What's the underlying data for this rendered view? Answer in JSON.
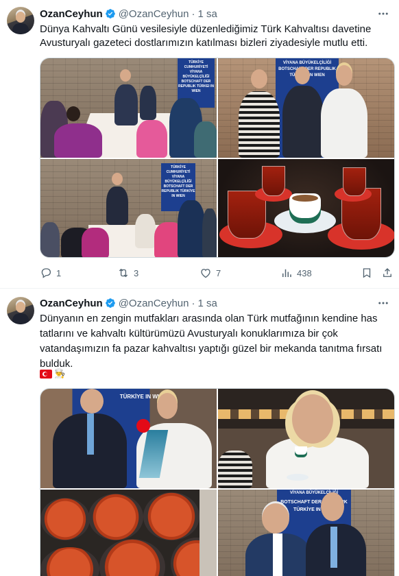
{
  "tweets": [
    {
      "name": "OzanCeyhun",
      "handle": "@OzanCeyhun",
      "dot": "·",
      "time": "1 sa",
      "text_lines": [
        "Dünya Kahvaltı Günü vesilesiyle düzenlediğimiz Türk Kahvaltısı davetine",
        "Avusturyalı gazeteci dostlarımızın katılması bizleri ziyadesiyle mutlu etti."
      ],
      "banners": {
        "p1": "TÜRKİYE CUMHURİYETİ VİYANA BÜYÜKELÇİLİĞİ BOTSCHAFT DER REPUBLIK TÜRKEI IN WIEN",
        "p2": "VİYANA BÜYÜKELÇİLİĞİ BOTSCHAFT DER REPUBLIK TÜRKİYE IN WIEN",
        "p3": "TÜRKİYE CUMHURİYETİ VİYANA BÜYÜKELÇİLİĞİ BOTSCHAFT DER REPUBLIK TÜRKİYE IN WIEN"
      },
      "replies": "1",
      "retweets": "3",
      "likes": "7",
      "views": "438"
    },
    {
      "name": "OzanCeyhun",
      "handle": "@OzanCeyhun",
      "dot": "·",
      "time": "1 sa",
      "text_lines": [
        "Dünyanın en zengin mutfakları arasında olan Türk mutfağının kendine has",
        "tatlarını ve kahvaltı kültürümüzü Avusturyalı konuklarımıza bir çok",
        "vatandaşımızın fa pazar kahvaltısı yaptığı güzel bir mekanda tanıtma fırsatı",
        "bulduk."
      ],
      "emojis": [
        "turkish-flag",
        "cook"
      ],
      "banners": {
        "p1": "TÜRKİYE IN WIEN",
        "p4a": "VİYANA BÜYÜKELÇİLİĞİ",
        "p4b": "BOTSCHAFT DER REPUBLIK TÜRKİYE IN WIEN"
      }
    }
  ],
  "colors": {
    "verified": "#1d9bf0",
    "muted": "#536471",
    "text": "#0f1419",
    "border": "#cfd9de"
  },
  "icons": [
    "verified-badge-icon",
    "more-icon",
    "reply-icon",
    "retweet-icon",
    "like-icon",
    "views-icon",
    "bookmark-icon",
    "share-icon"
  ]
}
